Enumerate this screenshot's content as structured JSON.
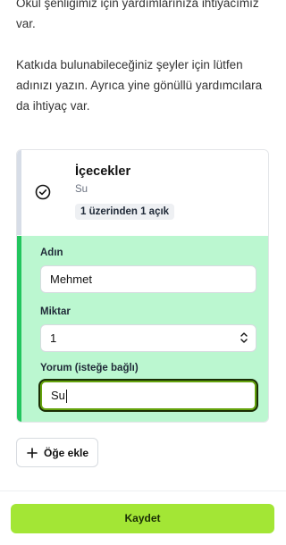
{
  "intro": {
    "paragraph1": "Okul şenliğimiz için yardımlarınıza ihtiyacımız var.",
    "paragraph2": "Katkıda bulunabileceğiniz şeyler için lütfen adınızı yazın. Ayrıca yine gönüllü yardımcılara da ihtiyaç var."
  },
  "item": {
    "title": "İçecekler",
    "subtitle": "Su",
    "badge": "1 üzerinden 1 açık",
    "icon": "check-circle-icon"
  },
  "form": {
    "name_label": "Adın",
    "name_value": "Mehmet",
    "amount_label": "Miktar",
    "amount_value": "1",
    "comment_label": "Yorum (isteğe bağlı)",
    "comment_value": "Su"
  },
  "actions": {
    "add_item": "Öğe ekle",
    "save": "Kaydet"
  },
  "colors": {
    "form_bg": "#bbf7d0",
    "accent_bar": "#22c55e",
    "save_bg": "#a3e635"
  }
}
